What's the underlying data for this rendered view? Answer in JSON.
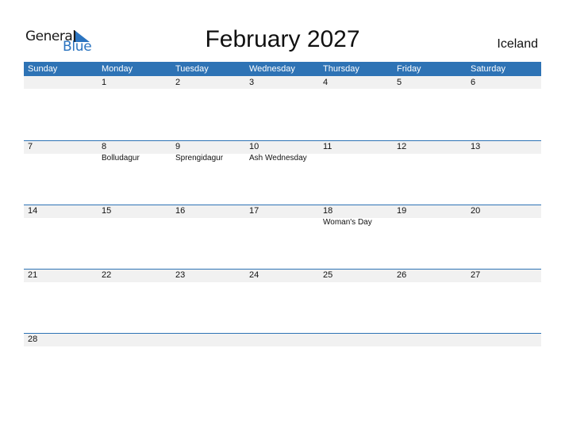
{
  "logo": {
    "word1": "General",
    "word2": "Blue"
  },
  "title": "February 2027",
  "country": "Iceland",
  "colors": {
    "header_bg": "#2e73b5",
    "date_strip_bg": "#f1f1f1",
    "logo_blue": "#2b74c0"
  },
  "weekdays": [
    "Sunday",
    "Monday",
    "Tuesday",
    "Wednesday",
    "Thursday",
    "Friday",
    "Saturday"
  ],
  "weeks": [
    [
      {
        "day": "",
        "event": ""
      },
      {
        "day": "1",
        "event": ""
      },
      {
        "day": "2",
        "event": ""
      },
      {
        "day": "3",
        "event": ""
      },
      {
        "day": "4",
        "event": ""
      },
      {
        "day": "5",
        "event": ""
      },
      {
        "day": "6",
        "event": ""
      }
    ],
    [
      {
        "day": "7",
        "event": ""
      },
      {
        "day": "8",
        "event": "Bolludagur"
      },
      {
        "day": "9",
        "event": "Sprengidagur"
      },
      {
        "day": "10",
        "event": "Ash Wednesday"
      },
      {
        "day": "11",
        "event": ""
      },
      {
        "day": "12",
        "event": ""
      },
      {
        "day": "13",
        "event": ""
      }
    ],
    [
      {
        "day": "14",
        "event": ""
      },
      {
        "day": "15",
        "event": ""
      },
      {
        "day": "16",
        "event": ""
      },
      {
        "day": "17",
        "event": ""
      },
      {
        "day": "18",
        "event": "Woman's Day"
      },
      {
        "day": "19",
        "event": ""
      },
      {
        "day": "20",
        "event": ""
      }
    ],
    [
      {
        "day": "21",
        "event": ""
      },
      {
        "day": "22",
        "event": ""
      },
      {
        "day": "23",
        "event": ""
      },
      {
        "day": "24",
        "event": ""
      },
      {
        "day": "25",
        "event": ""
      },
      {
        "day": "26",
        "event": ""
      },
      {
        "day": "27",
        "event": ""
      }
    ],
    [
      {
        "day": "28",
        "event": ""
      }
    ]
  ]
}
